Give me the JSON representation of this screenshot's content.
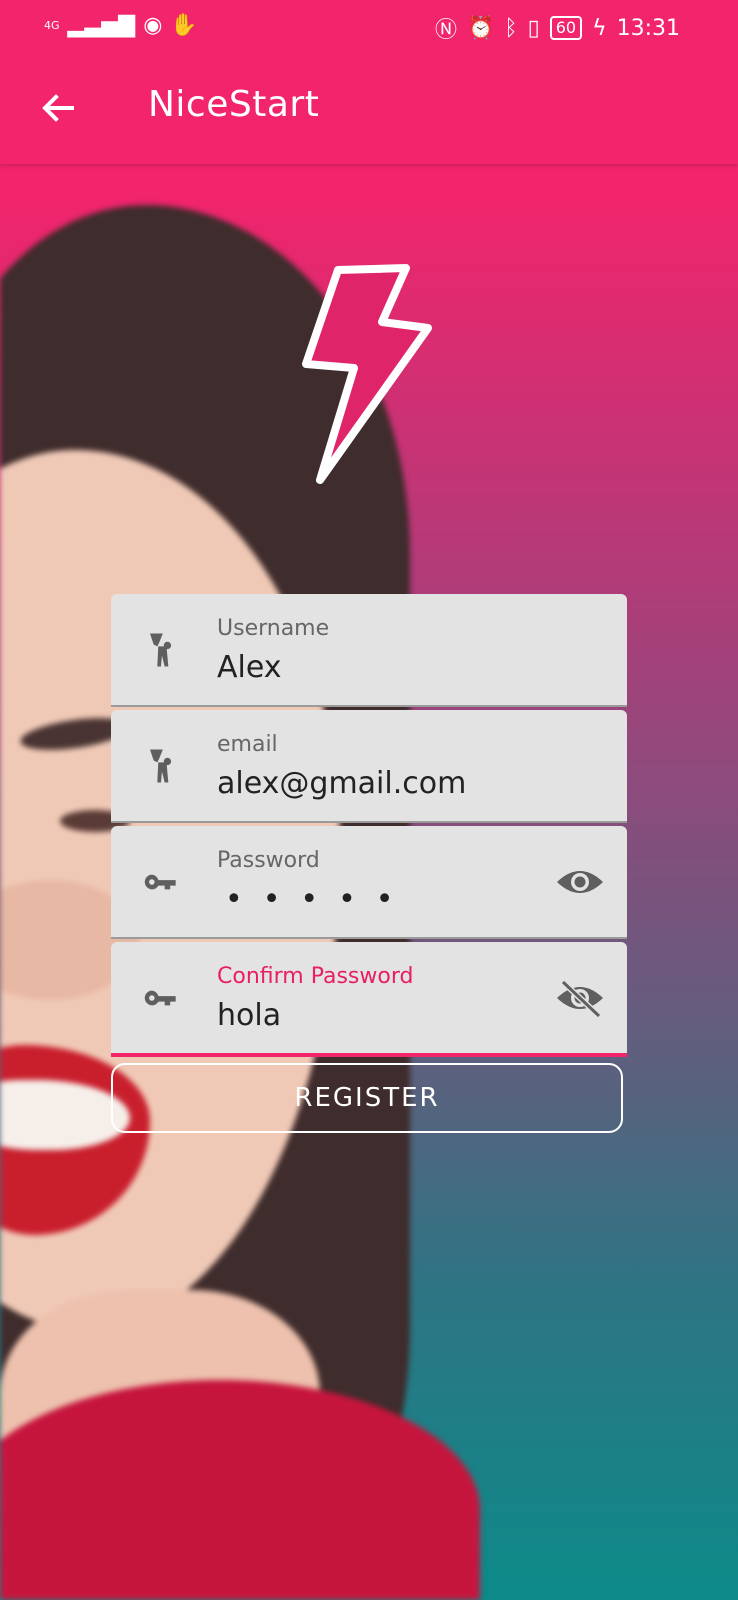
{
  "status_bar": {
    "signal": "4G",
    "time": "13:31",
    "battery": "60"
  },
  "app_bar": {
    "title": "NiceStart"
  },
  "form": {
    "fields": [
      {
        "label": "Username",
        "value": "Alex"
      },
      {
        "label": "email",
        "value": "alex@gmail.com"
      },
      {
        "label": "Password",
        "value": "•••••"
      },
      {
        "label": "Confirm Password",
        "value": "hola"
      }
    ],
    "register_label": "REGISTER"
  },
  "icons": {
    "back": "arrow-left-icon",
    "logo": "lightning-bolt-icon",
    "user": "person-waving-icon",
    "password": "key-icon",
    "visibility": "eye-icon",
    "visibility_off": "eye-off-icon"
  },
  "colors": {
    "accent": "#f2246c",
    "field_bg": "#e3e3e3"
  }
}
